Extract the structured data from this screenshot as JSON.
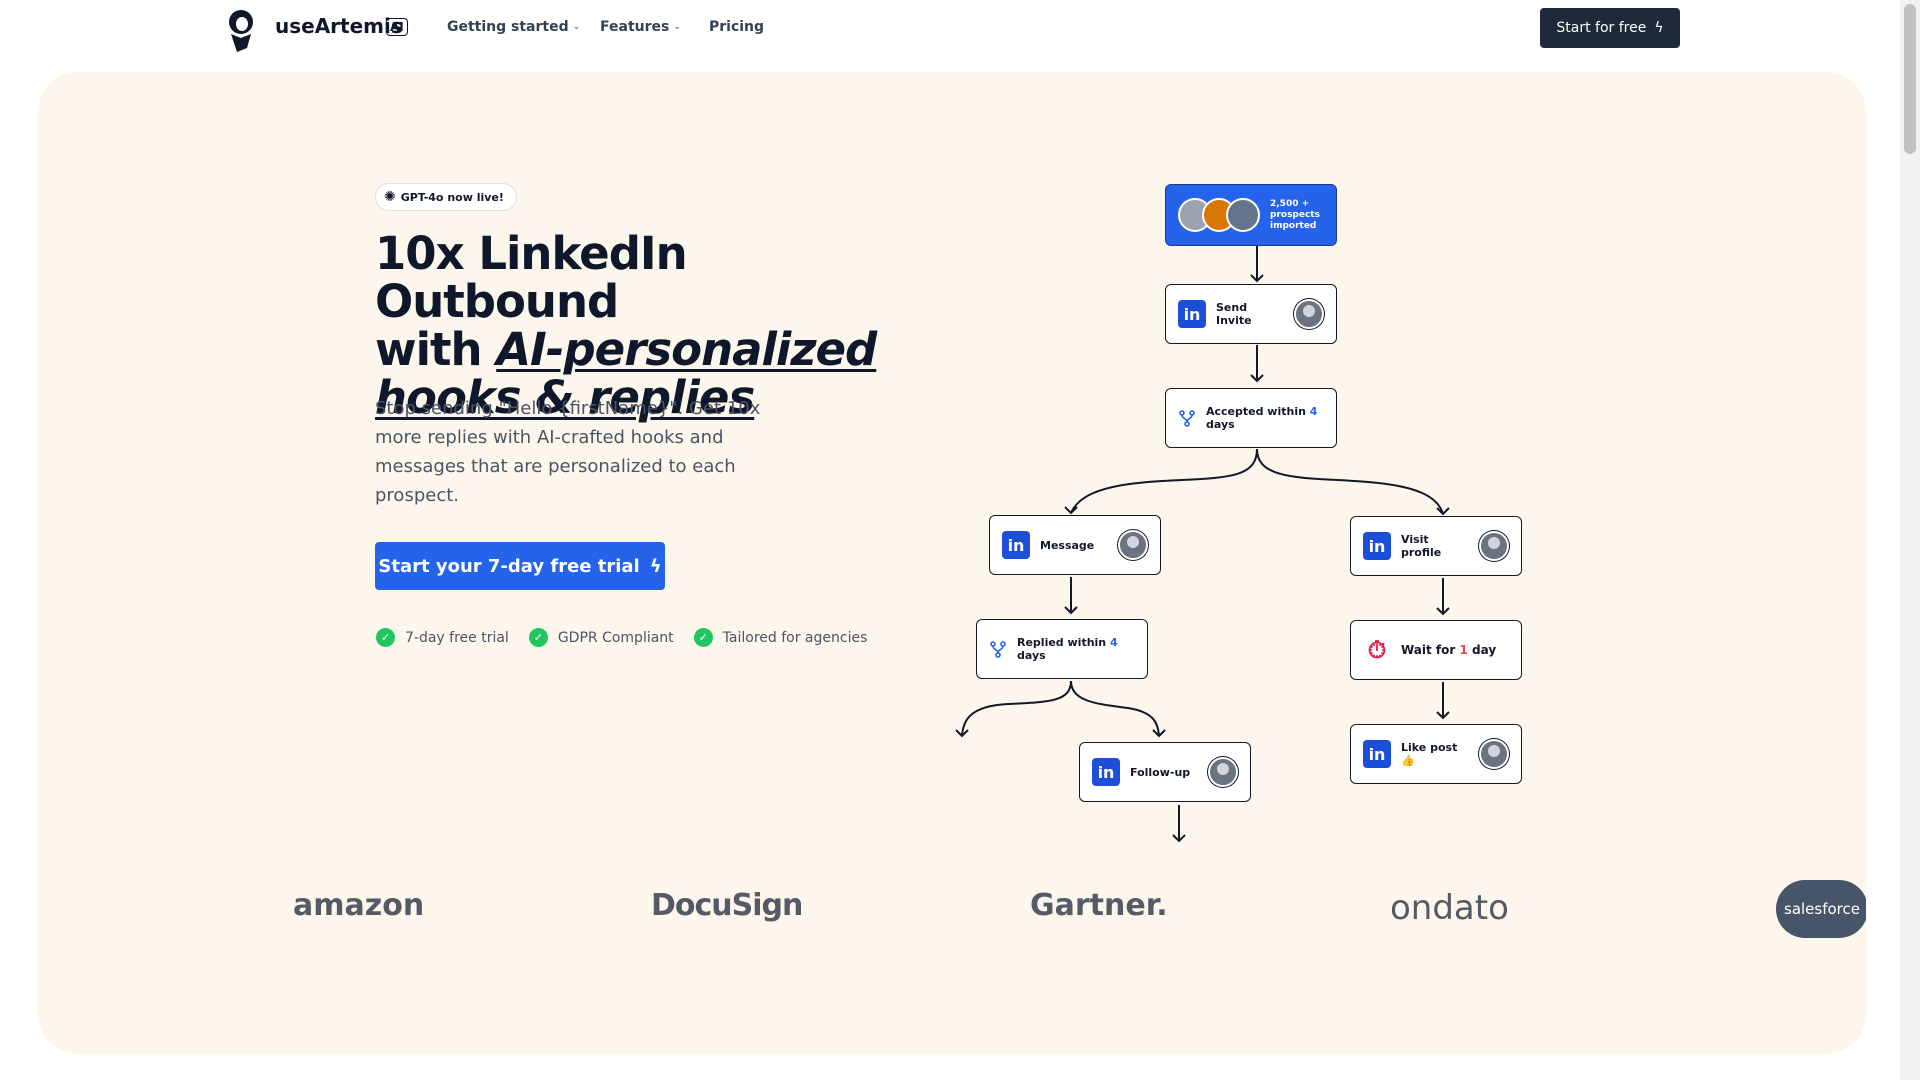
{
  "nav": {
    "brand": "useArtemis",
    "ai_badge": "AI",
    "links": [
      "Getting started",
      "Features",
      "Pricing"
    ],
    "cta": "Start for free"
  },
  "hero": {
    "badge": "GPT-4o now live!",
    "headline_line1": "10x LinkedIn Outbound",
    "headline_with": "with ",
    "headline_em1": "AI-personalized",
    "headline_em2": "hooks & replies",
    "subtitle": "Stop sending \"Hello {firstName}\". Get 10x more replies with AI-crafted hooks and messages that are personalized to each prospect.",
    "cta": "Start your 7-day free trial",
    "checks": [
      "7-day free trial",
      "GDPR Compliant",
      "Tailored for agencies"
    ]
  },
  "flow": {
    "prospects": "2,500 + prospects imported",
    "send_invite": "Send Invite",
    "accepted_prefix": "Accepted within ",
    "accepted_num": "4",
    "accepted_suffix": " days",
    "message": "Message",
    "visit_profile": "Visit profile",
    "replied_prefix": "Replied within ",
    "replied_num": "4",
    "replied_suffix": " days",
    "wait_prefix": "Wait for ",
    "wait_num": "1",
    "wait_suffix": " day",
    "follow_up": "Follow-up",
    "like_post": "Like post 👍"
  },
  "logos": [
    "amazon",
    "DocuSign",
    "Gartner.",
    "ondato",
    "salesforce"
  ],
  "colors": {
    "accent": "#2563eb",
    "dark": "#1e293b",
    "hero_bg": "#fdf6ec",
    "check": "#22c55e"
  }
}
